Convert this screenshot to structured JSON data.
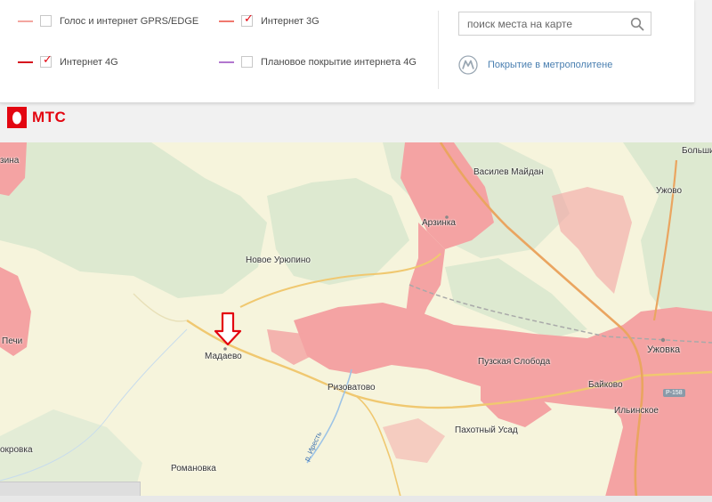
{
  "legend": [
    {
      "label": "Голос и интернет GPRS/EDGE",
      "color": "#f3a6a0",
      "checked": false
    },
    {
      "label": "Интернет 3G",
      "color": "#f0786e",
      "checked": true
    },
    {
      "label": "Интернет 4G",
      "color": "#d6121e",
      "checked": true
    },
    {
      "label": "Плановое покрытие интернета 4G",
      "color": "#b276cf",
      "checked": false
    }
  ],
  "search": {
    "placeholder": "поиск места на карте"
  },
  "metro": {
    "label": "Покрытие в метрополитене"
  },
  "logo": {
    "label": "МТС"
  },
  "map": {
    "places": [
      "зина",
      "Большие",
      "Василев Майдан",
      "Ужово",
      "Арзинка",
      "Новое Урюпино",
      "Печи",
      "Мадаево",
      "Ужовка",
      "Пузская Слобода",
      "Байково",
      "Ризоватово",
      "Ильинское",
      "Пахотный Усад",
      "окровка",
      "Романовка"
    ],
    "river": "р. Иресть",
    "road": "Р-158"
  },
  "colors": {
    "coverage": "#f4a3a3",
    "forest": "#dde9d0",
    "field": "#f6f4dc",
    "road": "#f0c870",
    "highway": "#eaa560",
    "marker": "#e30611",
    "brand": "#e30611"
  }
}
